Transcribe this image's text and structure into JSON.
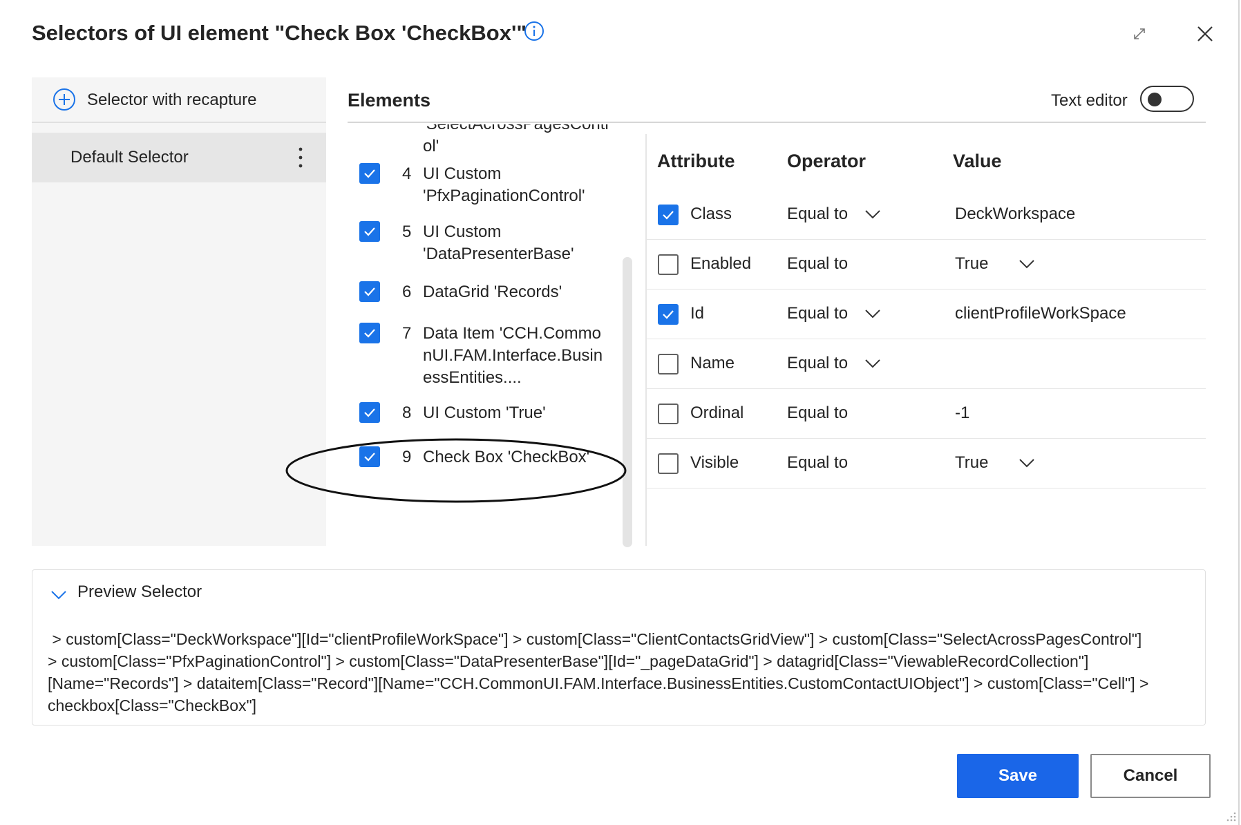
{
  "dialog": {
    "title": "Selectors of UI element \"Check Box 'CheckBox'\"",
    "icons": {
      "info": "info-icon",
      "expand": "expand-icon",
      "close": "close-icon"
    }
  },
  "left": {
    "recapture_label": "Selector with recapture",
    "selector_label": "Default Selector"
  },
  "elements": {
    "title": "Elements",
    "text_editor_label": "Text editor",
    "text_editor_on": false,
    "partial_top_line1": "'SelectAcrossPagesContr",
    "partial_top_line2": "ol'",
    "items": [
      {
        "num": "4",
        "text": "UI Custom 'PfxPaginationControl'",
        "checked": true
      },
      {
        "num": "5",
        "text": "UI Custom 'DataPresenterBase'",
        "checked": true
      },
      {
        "num": "6",
        "text": "DataGrid 'Records'",
        "checked": true
      },
      {
        "num": "7",
        "text": "Data Item 'CCH.CommonUI.FAM.Interface.BusinessEntities....",
        "checked": true
      },
      {
        "num": "8",
        "text": "UI Custom 'True'",
        "checked": true
      },
      {
        "num": "9",
        "text": "Check Box 'CheckBox'",
        "checked": true
      }
    ]
  },
  "attributes": {
    "headers": {
      "attribute": "Attribute",
      "operator": "Operator",
      "value": "Value"
    },
    "rows": [
      {
        "name": "Class",
        "operator": "Equal to",
        "value": "DeckWorkspace",
        "checked": true
      },
      {
        "name": "Enabled",
        "operator": "Equal to",
        "value": "True",
        "checked": false
      },
      {
        "name": "Id",
        "operator": "Equal to",
        "value": "clientProfileWorkSpace",
        "checked": true
      },
      {
        "name": "Name",
        "operator": "Equal to",
        "value": "",
        "checked": false
      },
      {
        "name": "Ordinal",
        "operator": "Equal to",
        "value": "-1",
        "checked": false
      },
      {
        "name": "Visible",
        "operator": "Equal to",
        "value": "True",
        "checked": false
      }
    ]
  },
  "preview": {
    "title": "Preview Selector",
    "line1": " > custom[Class=\"DeckWorkspace\"][Id=\"clientProfileWorkSpace\"] > custom[Class=\"ClientContactsGridView\"] > custom[Class=\"SelectAcrossPagesControl\"]",
    "line2": "> custom[Class=\"PfxPaginationControl\"] > custom[Class=\"DataPresenterBase\"][Id=\"_pageDataGrid\"] > datagrid[Class=\"ViewableRecordCollection\"]",
    "line3": "[Name=\"Records\"] > dataitem[Class=\"Record\"][Name=\"CCH.CommonUI.FAM.Interface.BusinessEntities.CustomContactUIObject\"] > custom[Class=\"Cell\"] >",
    "line4": "checkbox[Class=\"CheckBox\"]"
  },
  "buttons": {
    "save": "Save",
    "cancel": "Cancel"
  },
  "colors": {
    "accent": "#1a73e8",
    "save_bg": "#1a66e8"
  }
}
